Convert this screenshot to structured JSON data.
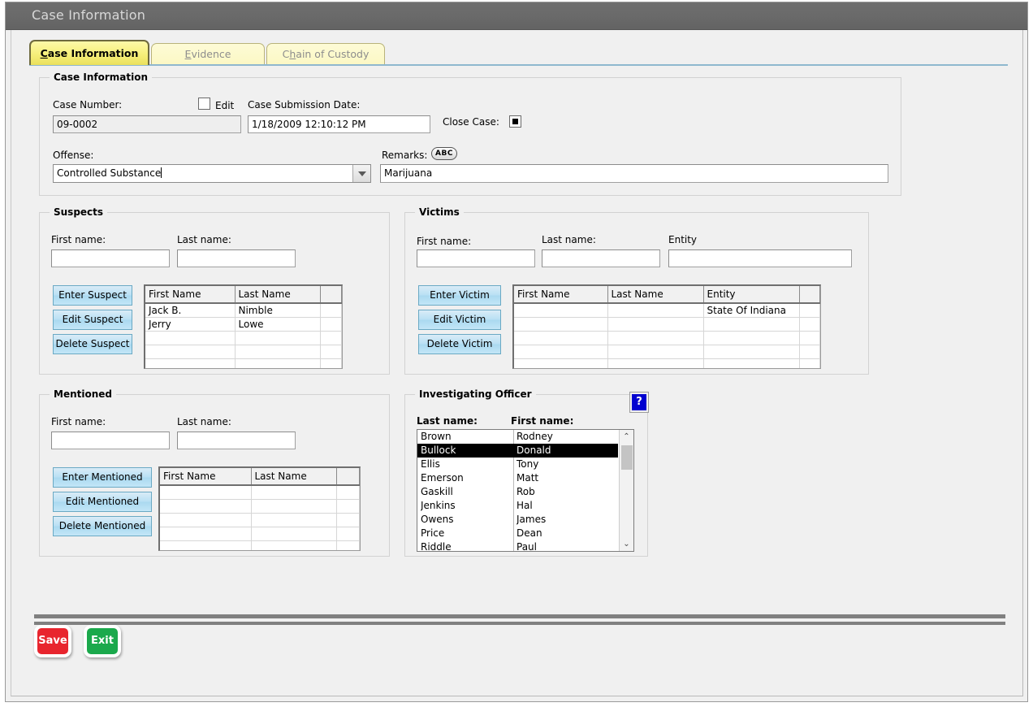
{
  "window": {
    "title": "Case Information"
  },
  "tabs": [
    {
      "label": "Case Information",
      "mnemonic": "C",
      "active": true
    },
    {
      "label": "Evidence",
      "mnemonic": "E",
      "active": false
    },
    {
      "label": "Chain of Custody",
      "mnemonic": "h",
      "active": false
    }
  ],
  "case_information": {
    "group_title": "Case Information",
    "case_number_label": "Case Number:",
    "case_number_value": "09-0002",
    "edit_label": "Edit",
    "edit_checked": false,
    "submission_date_label": "Case Submission Date:",
    "submission_date_value": "1/18/2009 12:10:12 PM",
    "close_case_label": "Close Case:",
    "close_case_checked": true,
    "offense_label": "Offense:",
    "offense_value": "Controlled Substance",
    "remarks_label": "Remarks:",
    "remarks_icon_text": "ABC",
    "remarks_value": "Marijuana"
  },
  "suspects": {
    "group_title": "Suspects",
    "first_name_label": "First name:",
    "first_name_value": "",
    "last_name_label": "Last name:",
    "last_name_value": "",
    "buttons": [
      "Enter Suspect",
      "Edit Suspect",
      "Delete Suspect"
    ],
    "columns": [
      "First Name",
      "Last Name",
      ""
    ],
    "rows": [
      [
        "Jack B.",
        "Nimble",
        ""
      ],
      [
        "Jerry",
        "Lowe",
        ""
      ],
      [
        "",
        "",
        ""
      ],
      [
        "",
        "",
        ""
      ],
      [
        "",
        "",
        ""
      ]
    ]
  },
  "victims": {
    "group_title": "Victims",
    "first_name_label": "First name:",
    "first_name_value": "",
    "last_name_label": "Last name:",
    "last_name_value": "",
    "entity_label": "Entity",
    "entity_value": "",
    "buttons": [
      "Enter Victim",
      "Edit Victim",
      "Delete Victim"
    ],
    "columns": [
      "First Name",
      "Last Name",
      "Entity",
      ""
    ],
    "rows": [
      [
        "",
        "",
        "State Of Indiana",
        ""
      ],
      [
        "",
        "",
        "",
        ""
      ],
      [
        "",
        "",
        "",
        ""
      ],
      [
        "",
        "",
        "",
        ""
      ],
      [
        "",
        "",
        "",
        ""
      ]
    ]
  },
  "mentioned": {
    "group_title": "Mentioned",
    "first_name_label": "First name:",
    "first_name_value": "",
    "last_name_label": "Last name:",
    "last_name_value": "",
    "buttons": [
      "Enter Mentioned",
      "Edit Mentioned",
      "Delete Mentioned"
    ],
    "columns": [
      "First Name",
      "Last Name",
      ""
    ],
    "rows": [
      [
        "",
        "",
        ""
      ],
      [
        "",
        "",
        ""
      ],
      [
        "",
        "",
        ""
      ],
      [
        "",
        "",
        ""
      ],
      [
        "",
        "",
        ""
      ]
    ]
  },
  "investigating_officer": {
    "group_title": "Investigating Officer",
    "last_name_label": "Last name:",
    "first_name_label": "First name:",
    "help_icon_text": "?",
    "selected_index": 1,
    "officers": [
      {
        "last": "Brown",
        "first": "Rodney"
      },
      {
        "last": "Bullock",
        "first": "Donald"
      },
      {
        "last": "Ellis",
        "first": "Tony"
      },
      {
        "last": "Emerson",
        "first": "Matt"
      },
      {
        "last": "Gaskill",
        "first": "Rob"
      },
      {
        "last": "Jenkins",
        "first": "Hal"
      },
      {
        "last": "Owens",
        "first": "James"
      },
      {
        "last": "Price",
        "first": "Dean"
      },
      {
        "last": "Riddle",
        "first": "Paul"
      }
    ],
    "scroll_up_glyph": "⌃",
    "scroll_down_glyph": "⌄"
  },
  "footer": {
    "save_label": "Save",
    "exit_label": "Exit",
    "save_color": "#e8252e",
    "exit_color": "#1ba94c"
  }
}
